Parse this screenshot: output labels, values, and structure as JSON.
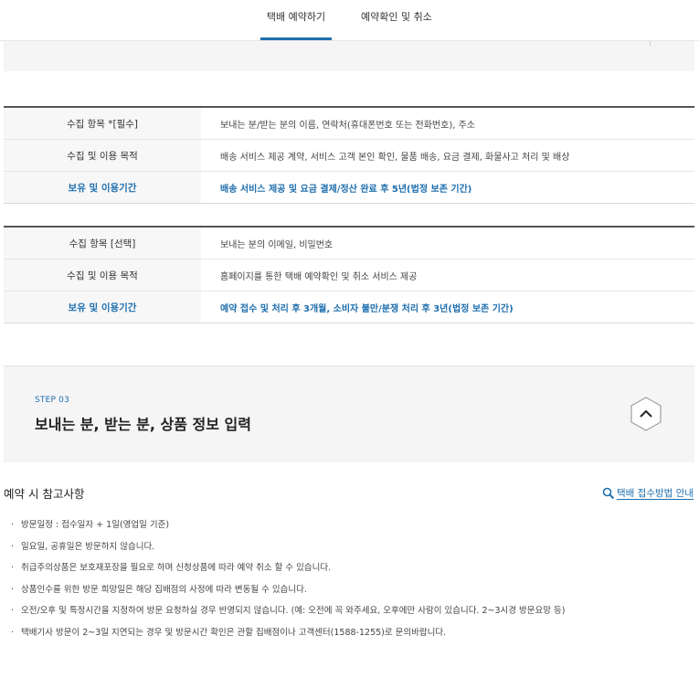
{
  "tabs": [
    {
      "label": "택배 예약하기",
      "active": true
    },
    {
      "label": "예약확인 및 취소",
      "active": false
    }
  ],
  "required_table": {
    "rows": [
      {
        "key": "수집 항목 *[필수]",
        "value": "보내는 분/받는 분의 이름, 연락처(휴대폰번호 또는 전화번호), 주소"
      },
      {
        "key": "수집 및 이용 목적",
        "value": "배송 서비스 제공 계약, 서비스 고객 본인 확인, 물품 배송, 요금 결제, 화물사고 처리 및 배상"
      },
      {
        "key": "보유 및 이용기간",
        "value": "배송 서비스 제공 및 요금 결제/정산 완료 후 5년(법정 보존 기간)"
      }
    ]
  },
  "optional_table": {
    "rows": [
      {
        "key": "수집 항목 [선택]",
        "value": "보내는 분의 이메일, 비밀번호"
      },
      {
        "key": "수집 및 이용 목적",
        "value": "홈페이지를 통한 택배 예약확인 및 취소 서비스 제공"
      },
      {
        "key": "보유 및 이용기간",
        "value": "예약 접수 및 처리 후 3개월, 소비자 불만/분쟁 처리 후 3년(법정 보존 기간)"
      }
    ]
  },
  "step": {
    "label": "STEP 03",
    "title": "보내는 분, 받는 분, 상품 정보 입력"
  },
  "reference": {
    "title": "예약 시 참고사항",
    "link": "택배 접수방법 안내",
    "notes": [
      "방문일정 : 접수일자 + 1일(영업일 기준)",
      "일요일, 공휴일은 방문하지 않습니다.",
      "취급주의상품은 보호재포장을 필요로 하며 신청상품에 따라 예약 취소 할 수 있습니다.",
      "상품인수를 위한 방문 희망일은 해당 집배점의 사정에 따라 변동될 수 있습니다.",
      "오전/오후 및 특정시간을 지정하여 방문 요청하실 경우 반영되지 않습니다. (예: 오전에 꼭 와주세요, 오후에만 사람이 있습니다. 2~3시경 방문요망 등)",
      "택배기사 방문이 2~3일 지연되는 경우 및 방문시간 확인은 관할 집배점이나 고객센터(1588-1255)로 문의바랍니다."
    ]
  },
  "colors": {
    "accent": "#1f6fae",
    "panel": "#f5f5f6"
  }
}
